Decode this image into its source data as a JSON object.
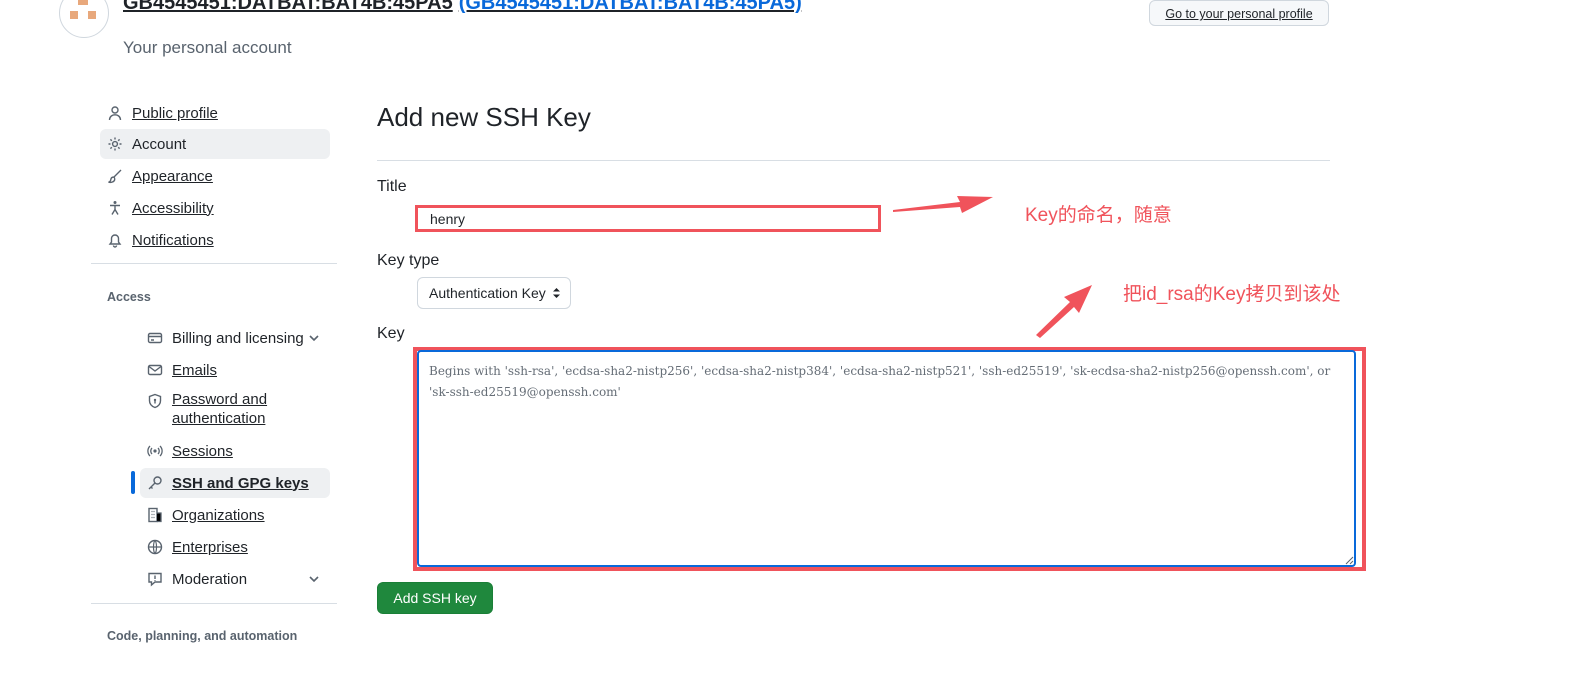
{
  "header": {
    "username": "GB4545451:DATBAT:BAT4B:45PA5",
    "username_alt": "(GB4545451:DATBAT:BAT4B:45PA5)",
    "subtitle": "Your personal account",
    "profile_button": "Go to your personal profile"
  },
  "sidebar": {
    "top_items": [
      {
        "label": "Public profile",
        "icon": "person-icon"
      },
      {
        "label": "Account",
        "icon": "gear-icon"
      },
      {
        "label": "Appearance",
        "icon": "paintbrush-icon"
      },
      {
        "label": "Accessibility",
        "icon": "accessibility-icon"
      },
      {
        "label": "Notifications",
        "icon": "bell-icon"
      }
    ],
    "access_heading": "Access",
    "access_items": [
      {
        "label": "Billing and licensing",
        "icon": "credit-card-icon"
      },
      {
        "label": "Emails",
        "icon": "mail-icon"
      },
      {
        "label": "Password and authentication",
        "label_line1": "Password and",
        "label_line2": "authentication",
        "icon": "shield-lock-icon"
      },
      {
        "label": "Sessions",
        "icon": "broadcast-icon"
      },
      {
        "label": "SSH and GPG keys",
        "icon": "key-icon"
      },
      {
        "label": "Organizations",
        "icon": "organization-icon"
      },
      {
        "label": "Enterprises",
        "icon": "globe-icon"
      },
      {
        "label": "Moderation",
        "icon": "report-icon"
      }
    ],
    "code_heading": "Code, planning, and automation"
  },
  "main": {
    "title": "Add new SSH Key",
    "title_label": "Title",
    "title_value": "henry",
    "key_type_label": "Key type",
    "key_type_value": "Authentication Key",
    "key_label": "Key",
    "key_placeholder": "Begins with 'ssh-rsa', 'ecdsa-sha2-nistp256', 'ecdsa-sha2-nistp384', 'ecdsa-sha2-nistp521', 'ssh-ed25519', 'sk-ecdsa-sha2-nistp256@openssh.com', or 'sk-ssh-ed25519@openssh.com'",
    "submit": "Add SSH key"
  },
  "annotations": {
    "title_note": "Key的命名，随意",
    "key_note": "把id_rsa的Key拷贝到该处"
  },
  "colors": {
    "annotation": "#f0535b",
    "primary_button": "#1f883d",
    "focus": "#0969da"
  }
}
